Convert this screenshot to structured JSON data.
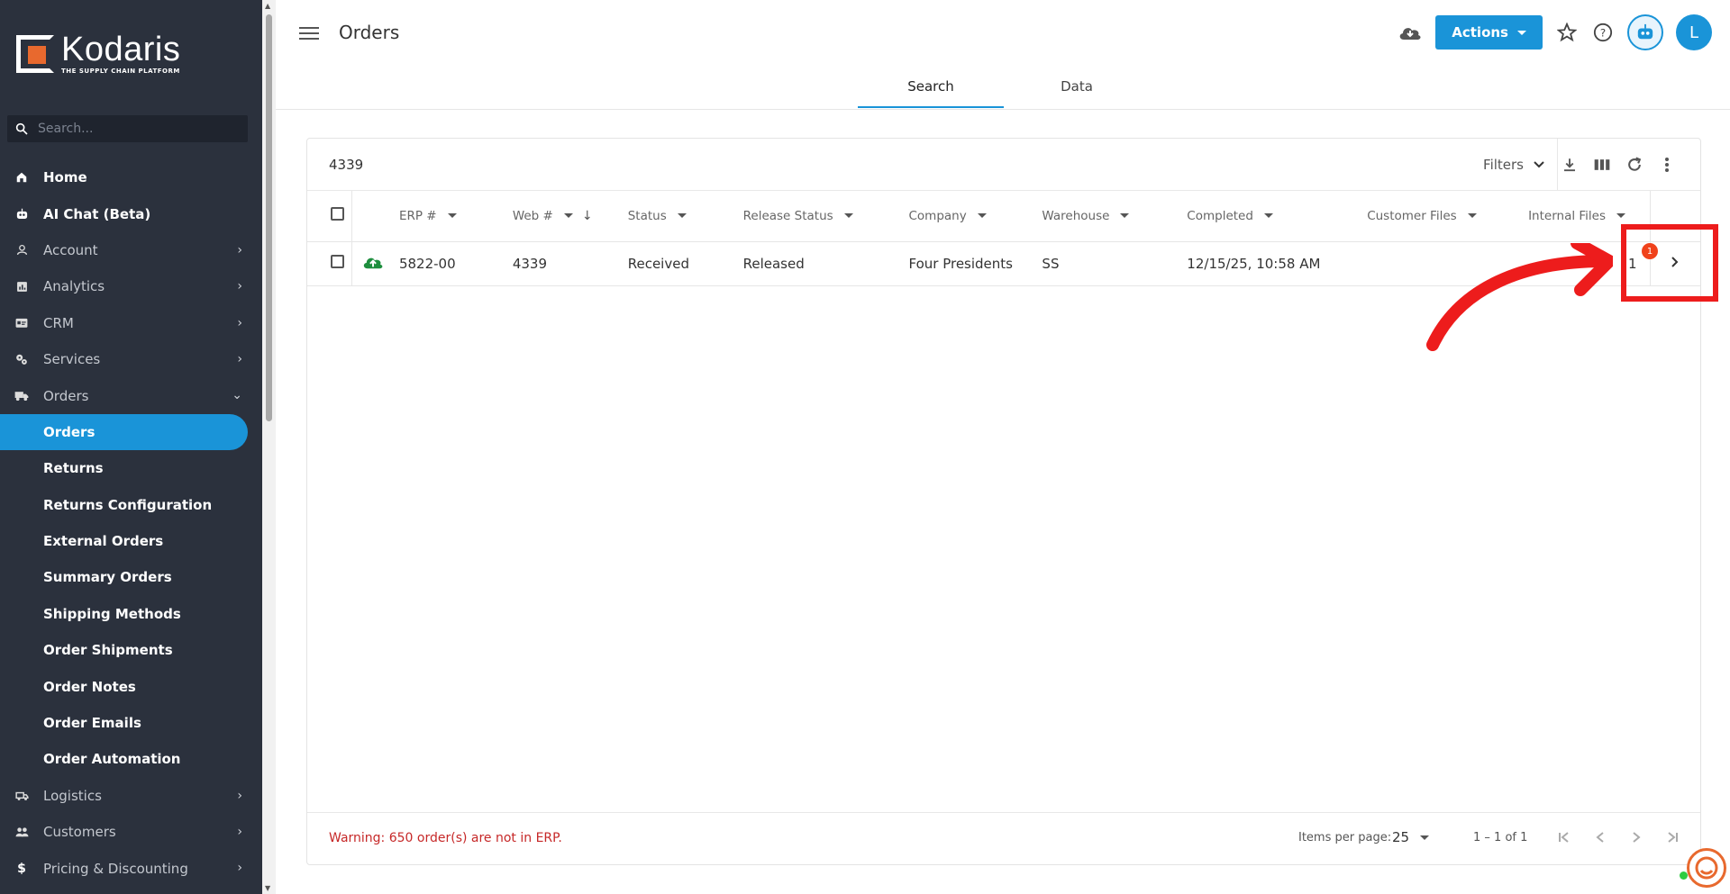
{
  "brand": {
    "name": "Kodaris",
    "tagline": "THE SUPPLY CHAIN PLATFORM",
    "accent": "#e8692e"
  },
  "sidebar": {
    "search_placeholder": "Search...",
    "items": [
      {
        "label": "Home",
        "icon": "home-icon",
        "has_chevron": false
      },
      {
        "label": "AI Chat (Beta)",
        "icon": "robot-icon",
        "has_chevron": false
      },
      {
        "label": "Account",
        "icon": "person-icon",
        "has_chevron": true
      },
      {
        "label": "Analytics",
        "icon": "chart-icon",
        "has_chevron": true
      },
      {
        "label": "CRM",
        "icon": "contact-card-icon",
        "has_chevron": true
      },
      {
        "label": "Services",
        "icon": "gears-icon",
        "has_chevron": true
      },
      {
        "label": "Orders",
        "icon": "truck-icon",
        "expanded": true
      }
    ],
    "orders_sub": [
      "Orders",
      "Returns",
      "Returns Configuration",
      "External Orders",
      "Summary Orders",
      "Shipping Methods",
      "Order Shipments",
      "Order Notes",
      "Order Emails",
      "Order Automation"
    ],
    "items_after": [
      {
        "label": "Logistics",
        "icon": "delivery-icon"
      },
      {
        "label": "Customers",
        "icon": "people-icon"
      },
      {
        "label": "Pricing & Discounting",
        "icon": "dollar-icon"
      }
    ]
  },
  "header": {
    "title": "Orders",
    "actions_label": "Actions",
    "avatar_letter": "L",
    "tabs": [
      "Search",
      "Data"
    ],
    "active_tab": "Search"
  },
  "table": {
    "search_term": "4339",
    "filters_label": "Filters",
    "columns": [
      "ERP #",
      "Web #",
      "Status",
      "Release Status",
      "Company",
      "Warehouse",
      "Completed",
      "Customer Files",
      "Internal Files"
    ],
    "rows": [
      {
        "erp": "5822-00",
        "web": "4339",
        "status": "Received",
        "release_status": "Released",
        "company": "Four Presidents",
        "warehouse": "SS",
        "completed": "12/15/25, 10:58 AM",
        "customer_files": "",
        "internal_files": "1",
        "badge": "1"
      }
    ]
  },
  "footer": {
    "warning": "Warning: 650 order(s) are not in ERP.",
    "items_per_page_label": "Items per page:",
    "items_per_page": "25",
    "range": "1 – 1 of 1"
  },
  "colors": {
    "primary": "#1a94d8",
    "sidebar_bg": "#2b313d",
    "warning": "#c62828",
    "annotation": "#ed1c1c",
    "badge": "#f0421b",
    "cloud_synced": "#1e8e3e"
  }
}
